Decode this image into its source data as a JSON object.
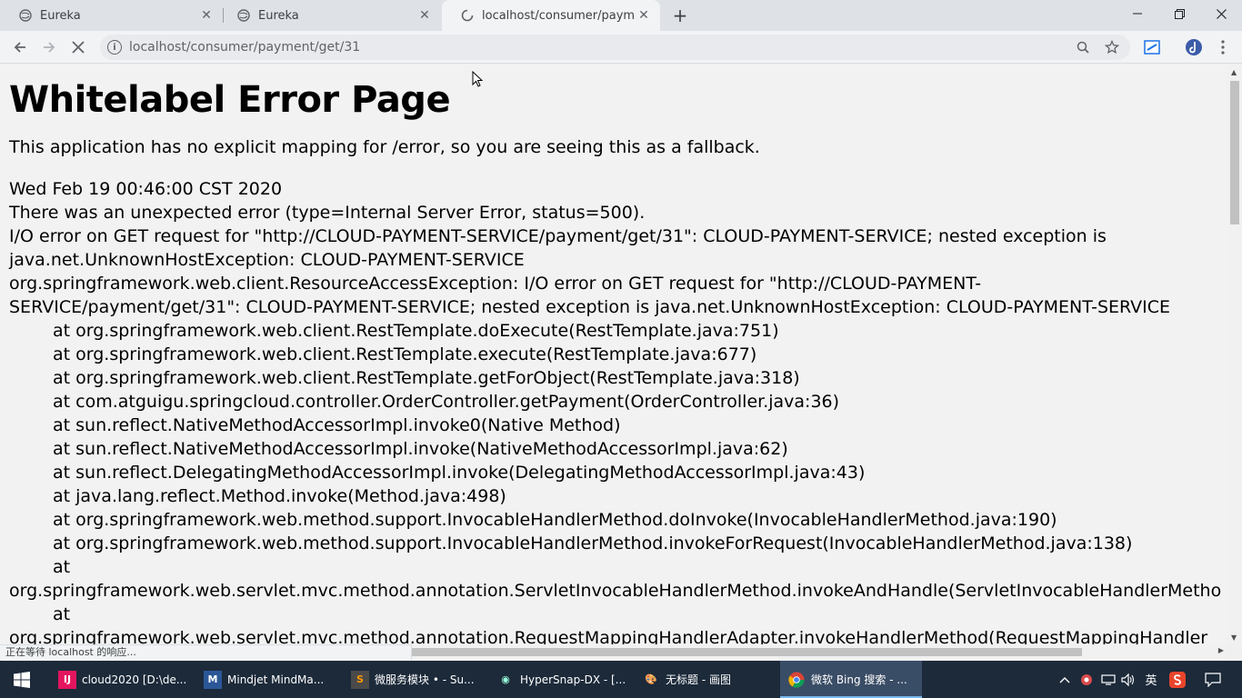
{
  "browser": {
    "tabs": [
      {
        "title": "Eureka",
        "icon": "globe-icon"
      },
      {
        "title": "Eureka",
        "icon": "globe-icon"
      },
      {
        "title": "localhost/consumer/payment/",
        "icon": "loading-spinner-icon"
      }
    ],
    "url": "localhost/consumer/payment/get/31",
    "status_text": "正在等待 localhost 的响应..."
  },
  "page": {
    "title": "Whitelabel Error Page",
    "intro": "This application has no explicit mapping for /error, so you are seeing this as a fallback.",
    "lines": [
      {
        "text": "Wed Feb 19 00:46:00 CST 2020",
        "indent": false
      },
      {
        "text": "There was an unexpected error (type=Internal Server Error, status=500).",
        "indent": false
      },
      {
        "text": "I/O error on GET request for \"http://CLOUD-PAYMENT-SERVICE/payment/get/31\": CLOUD-PAYMENT-SERVICE; nested exception is",
        "indent": false
      },
      {
        "text": "java.net.UnknownHostException: CLOUD-PAYMENT-SERVICE",
        "indent": false
      },
      {
        "text": "org.springframework.web.client.ResourceAccessException: I/O error on GET request for \"http://CLOUD-PAYMENT-",
        "indent": false
      },
      {
        "text": "SERVICE/payment/get/31\": CLOUD-PAYMENT-SERVICE; nested exception is java.net.UnknownHostException: CLOUD-PAYMENT-SERVICE",
        "indent": false
      },
      {
        "text": "at org.springframework.web.client.RestTemplate.doExecute(RestTemplate.java:751)",
        "indent": true
      },
      {
        "text": "at org.springframework.web.client.RestTemplate.execute(RestTemplate.java:677)",
        "indent": true
      },
      {
        "text": "at org.springframework.web.client.RestTemplate.getForObject(RestTemplate.java:318)",
        "indent": true
      },
      {
        "text": "at com.atguigu.springcloud.controller.OrderController.getPayment(OrderController.java:36)",
        "indent": true
      },
      {
        "text": "at sun.reflect.NativeMethodAccessorImpl.invoke0(Native Method)",
        "indent": true
      },
      {
        "text": "at sun.reflect.NativeMethodAccessorImpl.invoke(NativeMethodAccessorImpl.java:62)",
        "indent": true
      },
      {
        "text": "at sun.reflect.DelegatingMethodAccessorImpl.invoke(DelegatingMethodAccessorImpl.java:43)",
        "indent": true
      },
      {
        "text": "at java.lang.reflect.Method.invoke(Method.java:498)",
        "indent": true
      },
      {
        "text": "at org.springframework.web.method.support.InvocableHandlerMethod.doInvoke(InvocableHandlerMethod.java:190)",
        "indent": true
      },
      {
        "text": "at org.springframework.web.method.support.InvocableHandlerMethod.invokeForRequest(InvocableHandlerMethod.java:138)",
        "indent": true
      },
      {
        "text": "at",
        "indent": true
      },
      {
        "text": "org.springframework.web.servlet.mvc.method.annotation.ServletInvocableHandlerMethod.invokeAndHandle(ServletInvocableHandlerMetho",
        "indent": false
      },
      {
        "text": "at",
        "indent": true
      },
      {
        "text": "org.springframework.web.servlet.mvc.method.annotation.RequestMappingHandlerAdapter.invokeHandlerMethod(RequestMappingHandler",
        "indent": false
      }
    ]
  },
  "taskbar": {
    "items": [
      {
        "label": "cloud2020 [D:\\de...",
        "icon": "intellij-icon",
        "active": false
      },
      {
        "label": "Mindjet MindMa...",
        "icon": "mindjet-icon",
        "active": false
      },
      {
        "label": "微服务模块 • - Su...",
        "icon": "sublime-icon",
        "active": false
      },
      {
        "label": "HyperSnap-DX - [...",
        "icon": "hypersnap-icon",
        "active": false
      },
      {
        "label": "无标题 - 画图",
        "icon": "paint-icon",
        "active": false
      },
      {
        "label": "微软 Bing 搜索 - ...",
        "icon": "chrome-icon",
        "active": true
      }
    ],
    "ime_label": "英"
  }
}
